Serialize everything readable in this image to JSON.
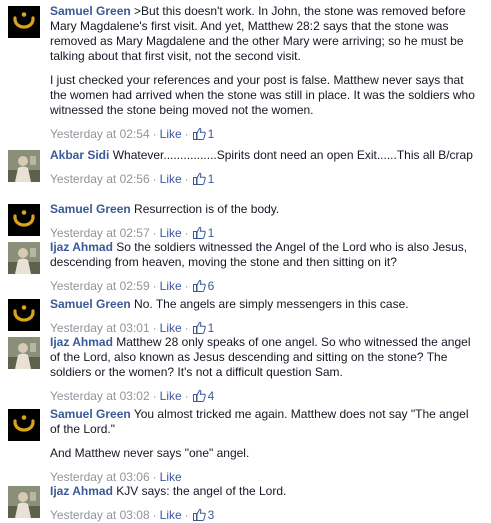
{
  "comments": [
    {
      "author": "Samuel Green",
      "avatar": "nun-symbol-icon",
      "paragraphs": [
        ">But this doesn't work. In John, the stone was removed before Mary Magdalene's first visit. And yet, Matthew 28:2 says that the stone was removed as Mary Magdalene and the other Mary were arriving; so he must be talking about that first visit, not the second visit.",
        "I just checked your references and your post is false. Matthew never says that the women had arrived when the stone was still in place. It was the soldiers who witnessed the stone being moved not the women."
      ],
      "timestamp": "Yesterday at 02:54",
      "like_label": "Like",
      "likes": "1"
    },
    {
      "author": "Akbar Sidi",
      "avatar": "profile-photo",
      "paragraphs": [
        "Whatever................Spirits dont need an open Exit......This all B/crap"
      ],
      "timestamp": "Yesterday at 02:56",
      "like_label": "Like",
      "likes": "1"
    },
    {
      "author": "Samuel Green",
      "avatar": "nun-symbol-icon",
      "paragraphs": [
        "Resurrection is of the body."
      ],
      "timestamp": "Yesterday at 02:57",
      "like_label": "Like",
      "likes": "1"
    },
    {
      "author": "Ijaz Ahmad",
      "avatar": "profile-photo",
      "paragraphs": [
        "So the soldiers witnessed the Angel of the Lord who is also Jesus, descending from heaven, moving the stone and then sitting on it?"
      ],
      "timestamp": "Yesterday at 02:59",
      "like_label": "Like",
      "likes": "6"
    },
    {
      "author": "Samuel Green",
      "avatar": "nun-symbol-icon",
      "paragraphs": [
        "No. The angels are simply messengers in this case."
      ],
      "timestamp": "Yesterday at 03:01",
      "like_label": "Like",
      "likes": "1"
    },
    {
      "author": "Ijaz Ahmad",
      "avatar": "profile-photo",
      "paragraphs": [
        "Matthew 28 only speaks of one angel. So who witnessed the angel of the Lord, also known as Jesus descending and sitting on the stone? The soldiers or the women? It's not a difficult question Sam."
      ],
      "timestamp": "Yesterday at 03:02",
      "like_label": "Like",
      "likes": "4"
    },
    {
      "author": "Samuel Green",
      "avatar": "nun-symbol-icon",
      "paragraphs": [
        "You almost tricked me again. Matthew does not say \"The angel of the Lord.\"",
        "And Matthew never says \"one\" angel."
      ],
      "timestamp": "Yesterday at 03:06",
      "like_label": "Like",
      "likes": ""
    },
    {
      "author": "Ijaz Ahmad",
      "avatar": "profile-photo",
      "paragraphs": [
        "KJV says: the angel of the Lord."
      ],
      "timestamp": "Yesterday at 03:08",
      "like_label": "Like",
      "likes": "3"
    }
  ],
  "colors": {
    "link": "#3b5998",
    "meta": "#90949c",
    "text": "#141823",
    "nun_symbol": "#d9a31a"
  }
}
